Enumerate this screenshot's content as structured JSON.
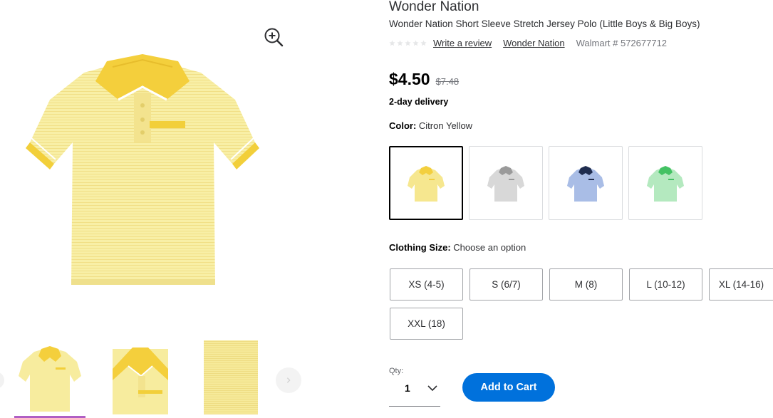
{
  "product": {
    "brand": "Wonder Nation",
    "name": "Wonder Nation Short Sleeve Stretch Jersey Polo (Little Boys & Big Boys)",
    "rating": 0,
    "write_review_label": "Write a review",
    "brand_link_label": "Wonder Nation",
    "sku_label": "Walmart # 572677712"
  },
  "pricing": {
    "price": "$4.50",
    "was_price": "$7.48",
    "delivery": "2-day delivery"
  },
  "color": {
    "label": "Color:",
    "selected": "Citron Yellow",
    "swatches": [
      {
        "name": "Citron Yellow",
        "body": "#f6e78f",
        "collar": "#f3cf3e",
        "selected": true
      },
      {
        "name": "Gray",
        "body": "#d8d8d8",
        "collar": "#9a9a9a",
        "selected": false
      },
      {
        "name": "Blue",
        "body": "#a9bde6",
        "collar": "#1f2d4f",
        "selected": false
      },
      {
        "name": "Green",
        "body": "#b4e9bf",
        "collar": "#43c263",
        "selected": false
      }
    ]
  },
  "size": {
    "label": "Clothing Size:",
    "prompt": "Choose an option",
    "options": [
      "XS (4-5)",
      "S (6/7)",
      "M (8)",
      "L (10-12)",
      "XL (14-16)",
      "XXL (18)"
    ]
  },
  "quantity": {
    "label": "Qty:",
    "value": "1"
  },
  "cart": {
    "add_label": "Add to Cart"
  },
  "colors": {
    "accent": "#0071dc",
    "active_thumb": "#b05ec4",
    "shirt_body": "#f7ec9e",
    "shirt_collar": "#f4cf3c"
  }
}
